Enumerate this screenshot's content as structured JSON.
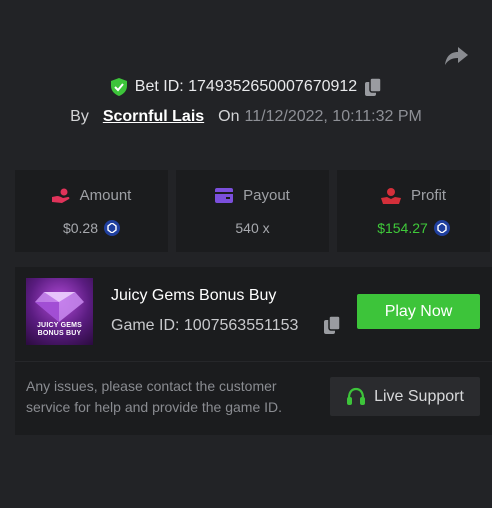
{
  "header": {
    "bet_id_text": "Bet ID: 1749352650007670912",
    "by_label": "By",
    "username": "Scornful Lais",
    "on_label": "On",
    "datetime": "11/12/2022, 10:11:32 PM"
  },
  "stats": [
    {
      "label": "Amount",
      "value": "$0.28",
      "icon": "hand-coin-icon",
      "icon_color": "#e0335a"
    },
    {
      "label": "Payout",
      "value": "540 x",
      "icon": "wallet-icon",
      "icon_color": "#7b4fdc"
    },
    {
      "label": "Profit",
      "value": "$154.27",
      "icon": "profit-icon",
      "icon_color": "#d42f3a"
    }
  ],
  "game": {
    "title": "Juicy Gems Bonus Buy",
    "id_text": "Game ID: 1007563551153",
    "thumb_line1": "JUICY GEMS",
    "thumb_line2": "BONUS BUY",
    "play_label": "Play Now"
  },
  "support": {
    "help_text": "Any issues, please contact the customer service for help and provide the game ID.",
    "button_label": "Live Support"
  },
  "colors": {
    "background": "#222326",
    "card": "#1b1c1e",
    "accent_green": "#3dc43a",
    "profit_green": "#3fc93a",
    "verified_green": "#3dc43a"
  }
}
